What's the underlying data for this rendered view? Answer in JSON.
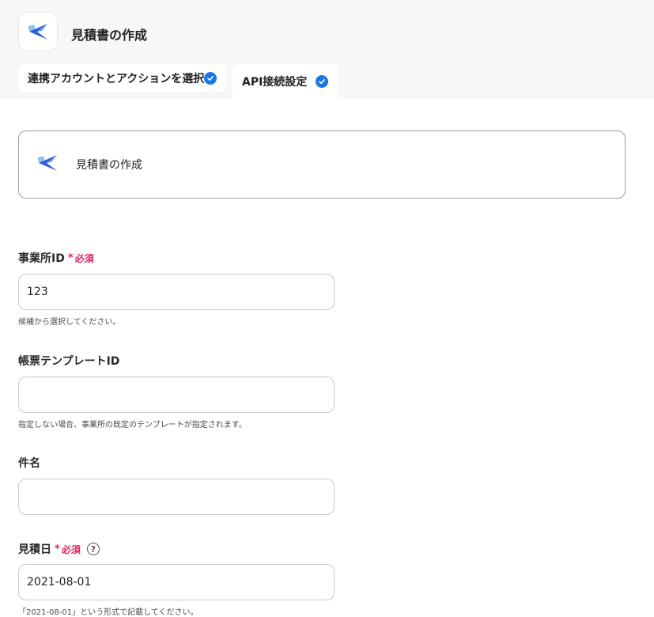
{
  "header": {
    "title": "見積書の作成"
  },
  "tabs": [
    {
      "label": "連携アカウントとアクションを選択",
      "completed": true
    },
    {
      "label": "API接続設定",
      "completed": true
    }
  ],
  "action_card": {
    "title": "見積書の作成"
  },
  "fields": {
    "office_id": {
      "label": "事業所ID",
      "required_mark": "*",
      "required_text": "必須",
      "value": "123",
      "hint": "候補から選択してください。"
    },
    "template_id": {
      "label": "帳票テンプレートID",
      "value": "",
      "hint": "指定しない場合、事業所の既定のテンプレートが指定されます。"
    },
    "subject": {
      "label": "件名",
      "value": ""
    },
    "quote_date": {
      "label": "見積日",
      "required_mark": "*",
      "required_text": "必須",
      "help": "?",
      "value": "2021-08-01",
      "hint": "「2021-08-01」という形式で記載してください。"
    }
  },
  "colors": {
    "accent": "#1976e8",
    "required": "#e0245e",
    "header_bg": "#f7f7f9",
    "border": "#c9c9cf"
  },
  "icons": {
    "app_logo": "paper-plane-logo-icon",
    "tab_check": "check-circle-icon",
    "help": "question-circle-icon"
  }
}
